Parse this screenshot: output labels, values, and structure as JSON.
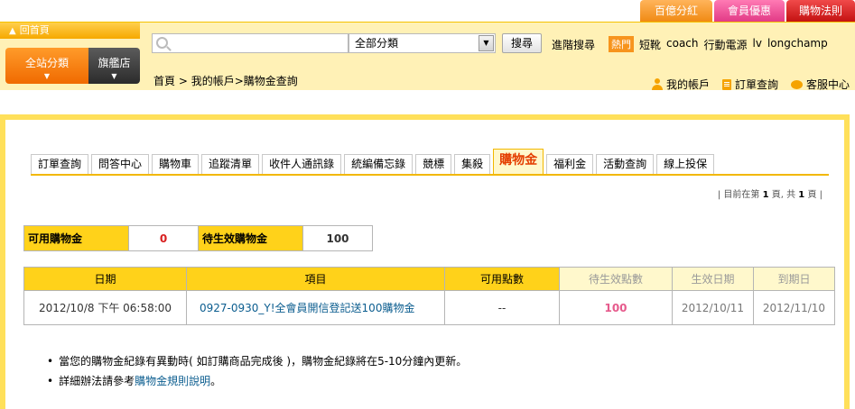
{
  "promo_tabs": [
    {
      "label": "百億分紅",
      "color": "#f59a22"
    },
    {
      "label": "會員優惠",
      "color": "#e8488f"
    },
    {
      "label": "購物法則",
      "color": "#d81e1e"
    }
  ],
  "header": {
    "home_label": "回首頁",
    "all_category_label": "全站分類",
    "flagship_label": "旗艦店",
    "search": {
      "value": "",
      "placeholder": ""
    },
    "category_select": {
      "selected": "全部分類"
    },
    "search_button": "搜尋",
    "advanced_search": "進階搜尋",
    "hot_label": "熱門",
    "hot_keywords": [
      "短靴",
      "coach",
      "行動電源",
      "lv",
      "longchamp"
    ]
  },
  "breadcrumb": {
    "items": [
      "首頁",
      "我的帳戶"
    ],
    "separator": " > ",
    "current": ">購物金查詢"
  },
  "right_links": {
    "account": "我的帳戶",
    "order_query": "訂單查詢",
    "support": "客服中心"
  },
  "tabs": [
    {
      "label": "訂單查詢",
      "active": false
    },
    {
      "label": "問答中心",
      "active": false
    },
    {
      "label": "購物車",
      "active": false
    },
    {
      "label": "追蹤清單",
      "active": false
    },
    {
      "label": "收件人通訊錄",
      "active": false
    },
    {
      "label": "統編備忘錄",
      "active": false
    },
    {
      "label": "競標",
      "active": false
    },
    {
      "label": "集殺",
      "active": false
    },
    {
      "label": "購物金",
      "active": true
    },
    {
      "label": "福利金",
      "active": false
    },
    {
      "label": "活動查詢",
      "active": false
    },
    {
      "label": "線上投保",
      "active": false
    }
  ],
  "pagination": {
    "prefix": "| 目前在第 ",
    "page": "1",
    "middle": " 頁, 共 ",
    "total": "1",
    "suffix": " 頁 |"
  },
  "summary": {
    "available_label": "可用購物金",
    "available_value": "0",
    "pending_label": "待生效購物金",
    "pending_value": "100"
  },
  "history_table": {
    "headers": [
      "日期",
      "項目",
      "可用點數",
      "待生效點數",
      "生效日期",
      "到期日"
    ],
    "rows": [
      {
        "date": "2012/10/8 下午 06:58:00",
        "item": "　0927-0930_Y!全會員開信登記送100購物金",
        "available": "--",
        "pending": "100",
        "effective_date": "2012/10/11",
        "expiry_date": "2012/11/10"
      }
    ]
  },
  "notes": {
    "line1": "當您的購物金紀錄有異動時( 如訂購商品完成後 )，購物金紀錄將在5-10分鐘內更新。",
    "line2_prefix": "詳細辦法請參考",
    "line2_link": "購物金規則說明",
    "line2_suffix": "。"
  },
  "colors": {
    "header_bg": "#fff1b6",
    "frame": "#ffe05a",
    "label_yellow": "#ffd21a",
    "active_tab": "#e43d00",
    "link_blue": "#0b5d8f",
    "pending_pink": "#e65a8c",
    "zero_red": "#d81e1e"
  }
}
